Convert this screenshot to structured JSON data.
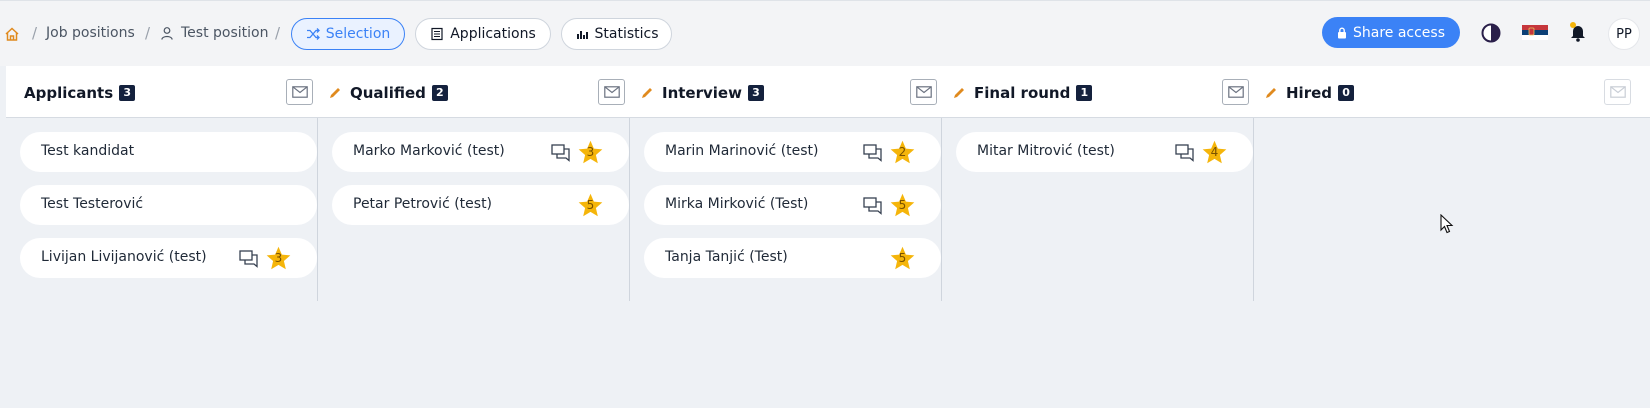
{
  "breadcrumb": {
    "items": [
      "Job positions",
      "Test position"
    ],
    "separator": "/"
  },
  "tabs": [
    "Selection",
    "Applications",
    "Statistics"
  ],
  "active_tab": "Selection",
  "share_label": "Share access",
  "avatar": "PP",
  "columns": [
    {
      "title": "Applicants",
      "count": "3",
      "editable": false,
      "mail_enabled": true,
      "cards": [
        {
          "name": "Test kandidat",
          "has_chat": false,
          "rating": ""
        },
        {
          "name": "Test Testerović",
          "has_chat": false,
          "rating": ""
        },
        {
          "name": "Livijan Livijanović (test)",
          "has_chat": true,
          "rating": "3"
        }
      ]
    },
    {
      "title": "Qualified",
      "count": "2",
      "editable": true,
      "mail_enabled": true,
      "cards": [
        {
          "name": "Marko Marković (test)",
          "has_chat": true,
          "rating": "3"
        },
        {
          "name": "Petar Petrović (test)",
          "has_chat": false,
          "rating": "5"
        }
      ]
    },
    {
      "title": "Interview",
      "count": "3",
      "editable": true,
      "mail_enabled": true,
      "cards": [
        {
          "name": "Marin Marinović (test)",
          "has_chat": true,
          "rating": "2"
        },
        {
          "name": "Mirka Mirković (Test)",
          "has_chat": true,
          "rating": "5"
        },
        {
          "name": "Tanja Tanjić (Test)",
          "has_chat": false,
          "rating": "5"
        }
      ]
    },
    {
      "title": "Final round",
      "count": "1",
      "editable": true,
      "mail_enabled": true,
      "cards": [
        {
          "name": "Mitar Mitrović (test)",
          "has_chat": true,
          "rating": "4"
        }
      ]
    },
    {
      "title": "Hired",
      "count": "0",
      "editable": true,
      "mail_enabled": false,
      "cards": []
    }
  ],
  "colors": {
    "accent": "#3b82f6",
    "star": "#f5b50a",
    "pencil": "#e08a1e",
    "badge": "#14213d"
  },
  "icons": [
    "home-icon",
    "person-icon",
    "shuffle-icon",
    "list-icon",
    "bar-chart-icon",
    "lock-icon",
    "theme-toggle-icon",
    "flag-icon",
    "bell-icon",
    "mail-icon",
    "pencil-icon",
    "chat-icon",
    "star-icon",
    "cursor-icon"
  ]
}
